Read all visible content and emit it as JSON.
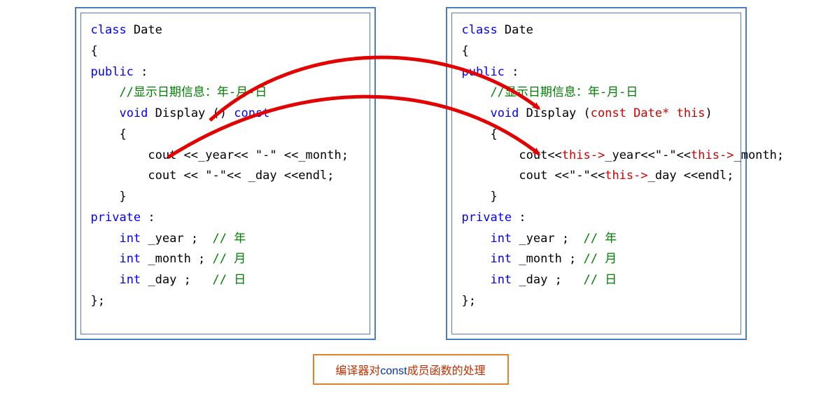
{
  "left": {
    "l1a": "class",
    "l1b": " Date",
    "l2": "{",
    "l3": "public",
    "l3b": " :",
    "l4": "    //显示日期信息：年-月-日",
    "l5a": "    ",
    "l5b": "void",
    "l5c": " Display () ",
    "l5d": "const",
    "l6": "    {",
    "l7": "        cout <<_year<< \"-\" <<_month;",
    "l8": "        cout << \"-\"<< _day <<endl;",
    "l9": "    }",
    "l10": "private",
    "l10b": " :",
    "l11a": "    ",
    "l11b": "int",
    "l11c": " _year ;  ",
    "l11d": "// 年",
    "l12a": "    ",
    "l12b": "int",
    "l12c": " _month ; ",
    "l12d": "// 月",
    "l13a": "    ",
    "l13b": "int",
    "l13c": " _day ;   ",
    "l13d": "// 日",
    "l14": "};"
  },
  "right": {
    "l1a": "class",
    "l1b": " Date",
    "l2": "{",
    "l3": "public",
    "l3b": " :",
    "l4": "    //显示日期信息：年-月-日",
    "l5a": "    ",
    "l5b": "void",
    "l5c": " Display (",
    "l5d": "const Date* this",
    "l5e": ")",
    "l6": "    {",
    "l7a": "        cout<<",
    "l7b": "this->",
    "l7c": "_year<<\"-\"<<",
    "l7d": "this->",
    "l7e": "_month;",
    "l8a": "        cout <<\"-\"<<",
    "l8b": "this->",
    "l8c": "_day <<endl;",
    "l9": "    }",
    "l10": "private",
    "l10b": " :",
    "l11a": "    ",
    "l11b": "int",
    "l11c": " _year ;  ",
    "l11d": "// 年",
    "l12a": "    ",
    "l12b": "int",
    "l12c": " _month ; ",
    "l12d": "// 月",
    "l13a": "    ",
    "l13b": "int",
    "l13c": " _day ;   ",
    "l13d": "// 日",
    "l14": "};"
  },
  "caption": {
    "t1": "编译器对",
    "t2": "const",
    "t3": "成员函数的处理"
  },
  "arrows": {
    "color": "#e20000"
  }
}
